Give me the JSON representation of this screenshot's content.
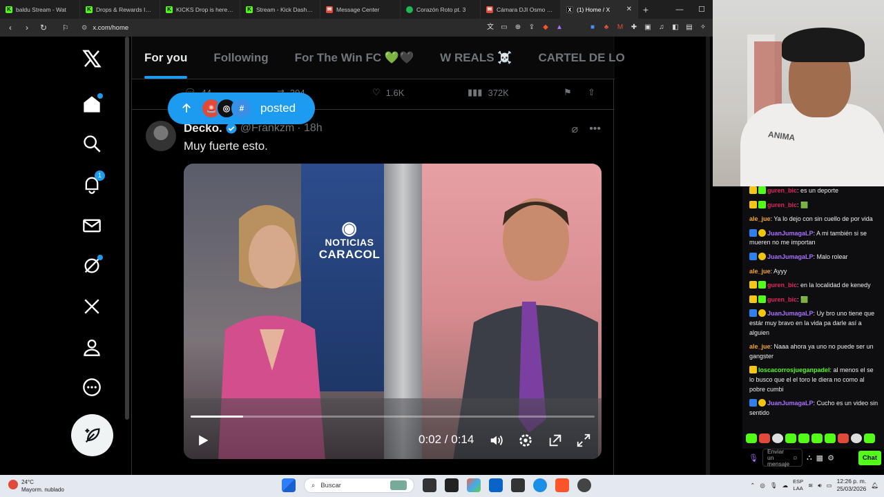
{
  "browser": {
    "tabs": [
      {
        "label": "baldu Stream - Wat",
        "icon": "kick"
      },
      {
        "label": "Drops & Rewards Inven",
        "icon": "kick"
      },
      {
        "label": "KICKS Drop is here: wat",
        "icon": "kick"
      },
      {
        "label": "Stream - Kick Dashboar",
        "icon": "kick"
      },
      {
        "label": "Message Center",
        "icon": "mail"
      },
      {
        "label": "Corazón Roto pt. 3",
        "icon": "spotify"
      },
      {
        "label": "Cámara DJI Osmo Pock",
        "icon": "mail"
      },
      {
        "label": "(1) Home / X",
        "icon": "x",
        "active": true
      }
    ],
    "url": "x.com/home"
  },
  "x": {
    "tabs": [
      "For you",
      "Following",
      "For The Win FC 💚🖤",
      "W REALS ☠️",
      "CARTEL DE LO"
    ],
    "notif_count": "1",
    "prev_post": {
      "replies": "44",
      "reposts": "394",
      "likes": "1.6K",
      "views": "372K"
    },
    "posted_pill": {
      "label": "posted"
    },
    "post": {
      "name": "Decko.",
      "handle": "@Frankzm",
      "time": "· 18h",
      "text": "Muy fuerte esto.",
      "video": {
        "time": "0:02 / 0:14",
        "progress": 0.13,
        "logo_line1": "NOTICIAS",
        "logo_line2": "CARACOL"
      }
    }
  },
  "chat": {
    "messages": [
      {
        "user": "guren_bic",
        "color": "red",
        "badges": [
          "crown",
          "green"
        ],
        "text": ": es un deporte"
      },
      {
        "user": "guren_bic",
        "color": "red",
        "badges": [
          "crown",
          "green"
        ],
        "text": ": 🟩"
      },
      {
        "user": "ale_jue",
        "color": "orange",
        "badges": [],
        "text": ": Ya lo dejo con sin cuello de por vida"
      },
      {
        "user": "JuanJumagaLP",
        "color": "purple",
        "badges": [
          "blue",
          "gold"
        ],
        "text": ": A mi también si se mueren no me importan"
      },
      {
        "user": "JuanJumagaLP",
        "color": "purple",
        "badges": [
          "blue",
          "gold"
        ],
        "text": ": Malo rolear"
      },
      {
        "user": "ale_jue",
        "color": "orange",
        "badges": [],
        "text": ": Ayyy"
      },
      {
        "user": "guren_bic",
        "color": "red",
        "badges": [
          "crown",
          "green"
        ],
        "text": ": en la localidad de kenedy"
      },
      {
        "user": "guren_bic",
        "color": "red",
        "badges": [
          "crown",
          "green"
        ],
        "text": ": 🟩"
      },
      {
        "user": "JuanJumagaLP",
        "color": "purple",
        "badges": [
          "blue",
          "gold"
        ],
        "text": ": Uy bro uno tiene que estár muy bravo en la vida pa darle así a alguien"
      },
      {
        "user": "ale_jue",
        "color": "orange",
        "badges": [],
        "text": ": Naaa ahora ya uno no puede ser un gangster"
      },
      {
        "user": "loscacorrosjueganpadel",
        "color": "green",
        "badges": [
          "crown"
        ],
        "text": ": al menos el se lo busco que el el toro le diera no como al pobre cumbi"
      },
      {
        "user": "JuanJumagaLP",
        "color": "purple",
        "badges": [
          "blue",
          "gold"
        ],
        "text": ": Cucho es un video sin sentido"
      }
    ],
    "input_placeholder": "Enviar un mensaje",
    "chat_button": "Chat"
  },
  "stream_cam": {
    "shirt_text": "ANIMA"
  },
  "taskbar": {
    "weather_temp": "24°C",
    "weather_desc": "Mayorm. nublado",
    "search_label": "Buscar",
    "lang1": "ESP",
    "lang2": "LAA",
    "time": "12:26 p. m.",
    "date": "25/03/2026"
  }
}
